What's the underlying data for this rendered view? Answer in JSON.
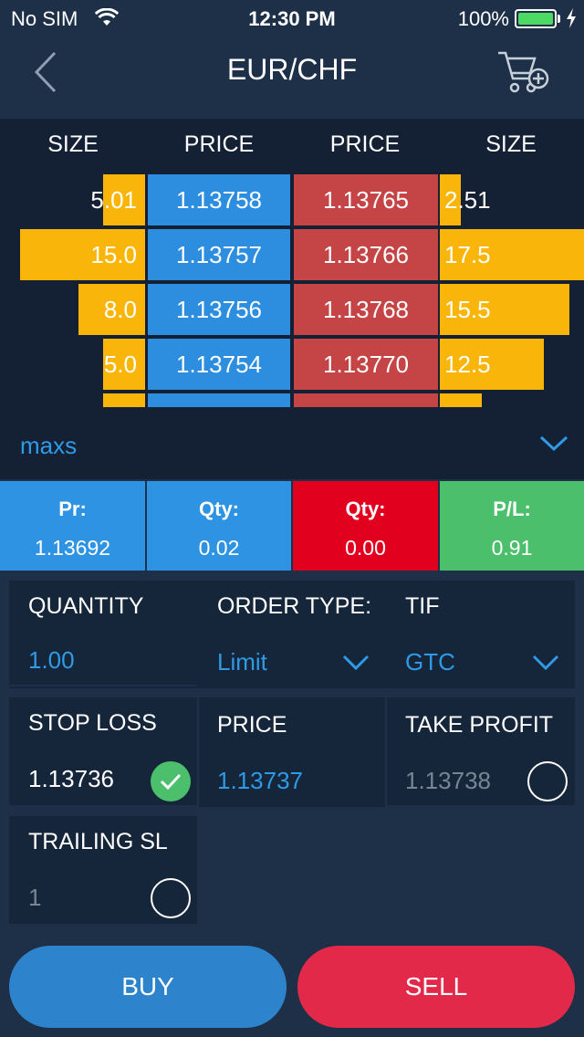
{
  "status_bar": {
    "carrier": "No SIM",
    "time": "12:30 PM",
    "battery_percent": "100%",
    "battery_level": 1.0
  },
  "nav": {
    "title": "EUR/CHF",
    "back_icon": "chevron-left-icon",
    "cart_icon": "cart-add-icon"
  },
  "order_book": {
    "headers": [
      "SIZE",
      "PRICE",
      "PRICE",
      "SIZE"
    ],
    "rows": [
      {
        "bid_size": "5.01",
        "bid_price": "1.13758",
        "ask_price": "1.13765",
        "ask_size": "2.51"
      },
      {
        "bid_size": "15.0",
        "bid_price": "1.13757",
        "ask_price": "1.13766",
        "ask_size": "17.5"
      },
      {
        "bid_size": "8.0",
        "bid_price": "1.13756",
        "ask_price": "1.13768",
        "ask_size": "15.5"
      },
      {
        "bid_size": "5.0",
        "bid_price": "1.13754",
        "ask_price": "1.13770",
        "ask_size": "12.5"
      }
    ],
    "colors": {
      "bid": "#2d8ee0",
      "ask": "#c54446",
      "size_bar": "#f9b50a"
    }
  },
  "account": {
    "label": "maxs"
  },
  "summary": [
    {
      "label": "Pr:",
      "value": "1.13692",
      "color": "#2e93e3"
    },
    {
      "label": "Qty:",
      "value": "0.02",
      "color": "#2e93e3"
    },
    {
      "label": "Qty:",
      "value": "0.00",
      "color": "#e2001f"
    },
    {
      "label": "P/L:",
      "value": "0.91",
      "color": "#4bbf6b"
    }
  ],
  "form": {
    "quantity": {
      "label": "QUANTITY",
      "value": "1.00"
    },
    "order_type": {
      "label": "ORDER TYPE:",
      "value": "Limit"
    },
    "tif": {
      "label": "TIF",
      "value": "GTC"
    },
    "stop_loss": {
      "label": "STOP LOSS",
      "value": "1.13736",
      "checked": true
    },
    "price": {
      "label": "PRICE",
      "value": "1.13737"
    },
    "take_profit": {
      "label": "TAKE PROFIT",
      "placeholder": "1.13738",
      "checked": false
    },
    "trailing_sl": {
      "label": "TRAILING SL",
      "placeholder": "1",
      "checked": false
    }
  },
  "actions": {
    "buy": {
      "label": "BUY",
      "color": "#2e84cc"
    },
    "sell": {
      "label": "SELL",
      "color": "#e2294a"
    }
  }
}
